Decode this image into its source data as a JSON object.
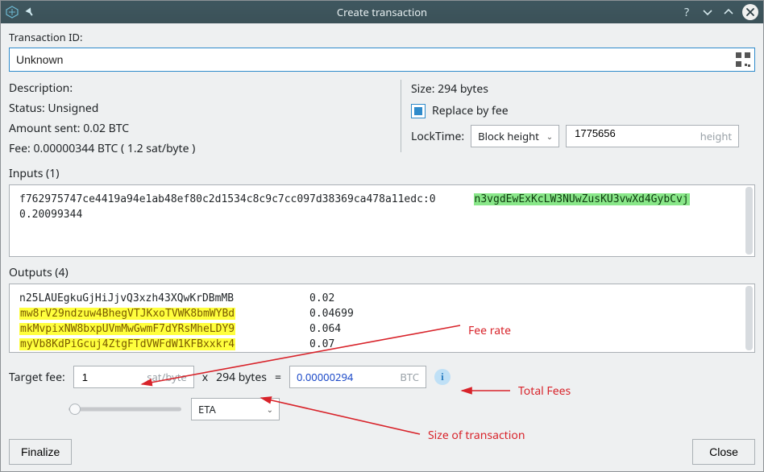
{
  "window": {
    "title": "Create transaction"
  },
  "labels": {
    "transaction_id": "Transaction ID:",
    "description": "Description:",
    "inputs": "Inputs (1)",
    "outputs": "Outputs (4)",
    "target_fee": "Target fee:",
    "finalize": "Finalize",
    "close": "Close"
  },
  "txid": {
    "value": "Unknown"
  },
  "left_panel": {
    "status": "Status: Unsigned",
    "amount_sent": "Amount sent: 0.02 BTC",
    "fee": "Fee: 0.00000344 BTC  ( 1.2 sat/byte )"
  },
  "right_panel": {
    "size": "Size: 294 bytes",
    "replace_by_fee_label": "Replace by fee",
    "replace_by_fee_checked": true,
    "locktime_label": "LockTime:",
    "locktime_type": "Block height",
    "locktime_value": "1775656",
    "locktime_unit": "height"
  },
  "inputs_box": {
    "txref": "f762975747ce4419a94e1ab48ef80c2d1534c8c9c7cc097d38369ca478a11edc:0",
    "address": "n3vgdEwExKcLW3NUwZusKU3vwXd4GybCvj",
    "amount": "0.20099344"
  },
  "outputs_box": {
    "rows": [
      {
        "addr": "n25LAUEgkuGjHiJjvQ3xzh43XQwKrDBmMB",
        "val": "0.02",
        "hl": false
      },
      {
        "addr": "mw8rV29ndzuw4BhegVTJKxoTVWK8bmWYBd",
        "val": "0.04699",
        "hl": true
      },
      {
        "addr": "mkMvpixNW8bxpUVmMwGwmF7dYRsMheLDY9",
        "val": "0.064",
        "hl": true
      },
      {
        "addr": "myVb8KdPiGcuj4ZtgFTdVWFdW1KFBxxkr4",
        "val": "0.07",
        "hl": true
      }
    ]
  },
  "fee_row": {
    "rate_value": "1",
    "rate_unit": "sat/byte",
    "times": "x",
    "size": "294 bytes",
    "equals": "=",
    "btc_value": "0.00000294",
    "btc_unit": "BTC",
    "eta": "ETA"
  },
  "annotations": {
    "fee_rate": "Fee rate",
    "total_fees": "Total Fees",
    "size_tx": "Size of transaction"
  }
}
